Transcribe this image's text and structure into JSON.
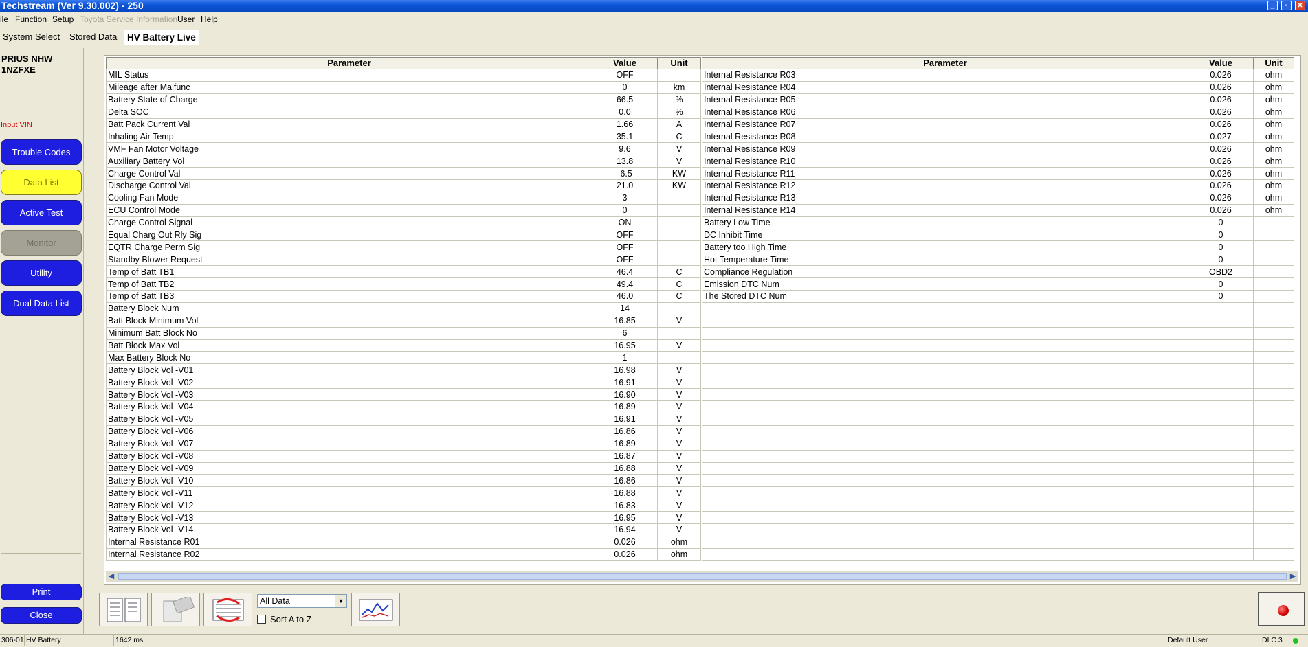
{
  "window": {
    "title": "Techstream (Ver 9.30.002) - 250"
  },
  "menu": {
    "items": [
      "ile",
      "Function",
      "Setup",
      "Toyota Service Information",
      "User",
      "Help"
    ]
  },
  "tabs": {
    "system_select": "System Select",
    "stored_data": "Stored Data",
    "hv_battery_live": "HV Battery Live"
  },
  "vehicle": {
    "model": "PRIUS NHW",
    "engine": "1NZFXE",
    "input_vin": "Input VIN"
  },
  "nav": {
    "trouble_codes": "Trouble Codes",
    "data_list": "Data List",
    "active_test": "Active Test",
    "monitor": "Monitor",
    "utility": "Utility",
    "dual_data_list": "Dual Data List",
    "print": "Print",
    "close": "Close"
  },
  "columns": {
    "parameter": "Parameter",
    "value": "Value",
    "unit": "Unit"
  },
  "left_rows": [
    {
      "p": "MIL Status",
      "v": "OFF",
      "u": ""
    },
    {
      "p": "Mileage after Malfunc",
      "v": "0",
      "u": "km"
    },
    {
      "p": "Battery State of Charge",
      "v": "66.5",
      "u": "%"
    },
    {
      "p": "Delta SOC",
      "v": "0.0",
      "u": "%"
    },
    {
      "p": "Batt Pack Current Val",
      "v": "1.66",
      "u": "A"
    },
    {
      "p": "Inhaling Air Temp",
      "v": "35.1",
      "u": "C"
    },
    {
      "p": "VMF Fan Motor Voltage",
      "v": "9.6",
      "u": "V"
    },
    {
      "p": "Auxiliary Battery Vol",
      "v": "13.8",
      "u": "V"
    },
    {
      "p": "Charge Control Val",
      "v": "-6.5",
      "u": "KW"
    },
    {
      "p": "Discharge Control Val",
      "v": "21.0",
      "u": "KW"
    },
    {
      "p": "Cooling Fan Mode",
      "v": "3",
      "u": ""
    },
    {
      "p": "ECU Control Mode",
      "v": "0",
      "u": ""
    },
    {
      "p": "Charge Control Signal",
      "v": "ON",
      "u": ""
    },
    {
      "p": "Equal Charg Out Rly Sig",
      "v": "OFF",
      "u": ""
    },
    {
      "p": "EQTR Charge Perm Sig",
      "v": "OFF",
      "u": ""
    },
    {
      "p": "Standby Blower Request",
      "v": "OFF",
      "u": ""
    },
    {
      "p": "Temp of Batt TB1",
      "v": "46.4",
      "u": "C"
    },
    {
      "p": "Temp of Batt TB2",
      "v": "49.4",
      "u": "C"
    },
    {
      "p": "Temp of Batt TB3",
      "v": "46.0",
      "u": "C"
    },
    {
      "p": "Battery Block Num",
      "v": "14",
      "u": ""
    },
    {
      "p": "Batt Block Minimum Vol",
      "v": "16.85",
      "u": "V"
    },
    {
      "p": "Minimum Batt Block No",
      "v": "6",
      "u": ""
    },
    {
      "p": "Batt Block Max Vol",
      "v": "16.95",
      "u": "V"
    },
    {
      "p": "Max Battery Block No",
      "v": "1",
      "u": ""
    },
    {
      "p": "Battery Block Vol -V01",
      "v": "16.98",
      "u": "V"
    },
    {
      "p": "Battery Block Vol -V02",
      "v": "16.91",
      "u": "V"
    },
    {
      "p": "Battery Block Vol -V03",
      "v": "16.90",
      "u": "V"
    },
    {
      "p": "Battery Block Vol -V04",
      "v": "16.89",
      "u": "V"
    },
    {
      "p": "Battery Block Vol -V05",
      "v": "16.91",
      "u": "V"
    },
    {
      "p": "Battery Block Vol -V06",
      "v": "16.86",
      "u": "V"
    },
    {
      "p": "Battery Block Vol -V07",
      "v": "16.89",
      "u": "V"
    },
    {
      "p": "Battery Block Vol -V08",
      "v": "16.87",
      "u": "V"
    },
    {
      "p": "Battery Block Vol -V09",
      "v": "16.88",
      "u": "V"
    },
    {
      "p": "Battery Block Vol -V10",
      "v": "16.86",
      "u": "V"
    },
    {
      "p": "Battery Block Vol -V11",
      "v": "16.88",
      "u": "V"
    },
    {
      "p": "Battery Block Vol -V12",
      "v": "16.83",
      "u": "V"
    },
    {
      "p": "Battery Block Vol -V13",
      "v": "16.95",
      "u": "V"
    },
    {
      "p": "Battery Block Vol -V14",
      "v": "16.94",
      "u": "V"
    },
    {
      "p": "Internal Resistance R01",
      "v": "0.026",
      "u": "ohm"
    },
    {
      "p": "Internal Resistance R02",
      "v": "0.026",
      "u": "ohm"
    }
  ],
  "right_rows": [
    {
      "p": "Internal Resistance R03",
      "v": "0.026",
      "u": "ohm"
    },
    {
      "p": "Internal Resistance R04",
      "v": "0.026",
      "u": "ohm"
    },
    {
      "p": "Internal Resistance R05",
      "v": "0.026",
      "u": "ohm"
    },
    {
      "p": "Internal Resistance R06",
      "v": "0.026",
      "u": "ohm"
    },
    {
      "p": "Internal Resistance R07",
      "v": "0.026",
      "u": "ohm"
    },
    {
      "p": "Internal Resistance R08",
      "v": "0.027",
      "u": "ohm"
    },
    {
      "p": "Internal Resistance R09",
      "v": "0.026",
      "u": "ohm"
    },
    {
      "p": "Internal Resistance R10",
      "v": "0.026",
      "u": "ohm"
    },
    {
      "p": "Internal Resistance R11",
      "v": "0.026",
      "u": "ohm"
    },
    {
      "p": "Internal Resistance R12",
      "v": "0.026",
      "u": "ohm"
    },
    {
      "p": "Internal Resistance R13",
      "v": "0.026",
      "u": "ohm"
    },
    {
      "p": "Internal Resistance R14",
      "v": "0.026",
      "u": "ohm"
    },
    {
      "p": "Battery Low Time",
      "v": "0",
      "u": ""
    },
    {
      "p": "DC Inhibit Time",
      "v": "0",
      "u": ""
    },
    {
      "p": "Battery too High Time",
      "v": "0",
      "u": ""
    },
    {
      "p": "Hot Temperature Time",
      "v": "0",
      "u": ""
    },
    {
      "p": "Compliance Regulation",
      "v": "OBD2",
      "u": ""
    },
    {
      "p": "Emission DTC Num",
      "v": "0",
      "u": ""
    },
    {
      "p": "The Stored DTC Num",
      "v": "0",
      "u": ""
    }
  ],
  "toolbar": {
    "data_filter": "All Data",
    "sort_label": "Sort A to Z"
  },
  "status": {
    "code": "306-01",
    "system": "HV Battery",
    "interval": "1642 ms",
    "user": "Default User",
    "connector": "DLC 3"
  },
  "icons": {
    "grid_left": "parameter-list-icon",
    "snapshot": "snapshot-icon",
    "refresh": "refresh-icon",
    "graph": "graph-icon",
    "record": "record-icon"
  }
}
